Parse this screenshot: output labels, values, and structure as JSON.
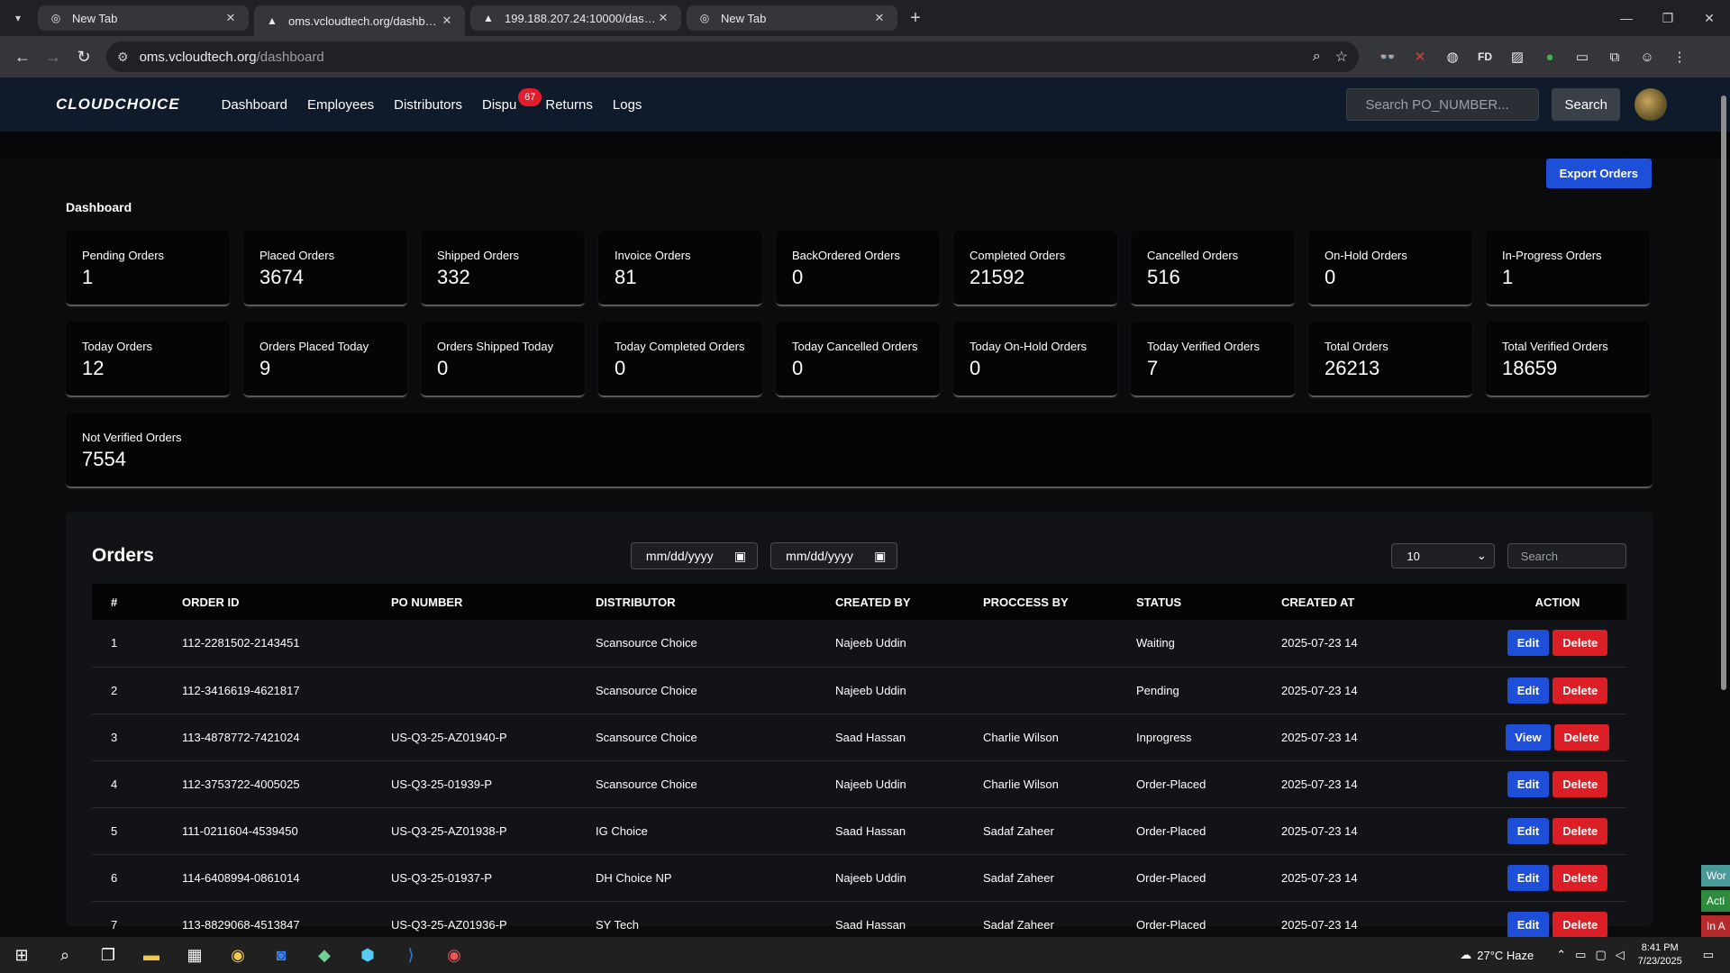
{
  "browser": {
    "tabs": [
      {
        "title": "New Tab",
        "active": false
      },
      {
        "title": "oms.vcloudtech.org/dashboard",
        "active": true
      },
      {
        "title": "199.188.207.24:10000/dashboa",
        "active": false
      },
      {
        "title": "New Tab",
        "active": false
      }
    ],
    "url_host": "oms.vcloudtech.org",
    "url_path": "/dashboard"
  },
  "nav": {
    "logo": "CLOUDCHOICE",
    "links": [
      "Dashboard",
      "Employees",
      "Distributors",
      "Dispu",
      "Returns",
      "Logs"
    ],
    "disputes_badge": "67",
    "search_placeholder": "Search PO_NUMBER...",
    "search_button": "Search"
  },
  "export_button": "Export Orders",
  "dashboard_title": "Dashboard",
  "cards_row1": [
    {
      "label": "Pending Orders",
      "value": "1"
    },
    {
      "label": "Placed Orders",
      "value": "3674"
    },
    {
      "label": "Shipped Orders",
      "value": "332"
    },
    {
      "label": "Invoice Orders",
      "value": "81"
    },
    {
      "label": "BackOrdered Orders",
      "value": "0"
    },
    {
      "label": "Completed Orders",
      "value": "21592"
    },
    {
      "label": "Cancelled Orders",
      "value": "516"
    },
    {
      "label": "On-Hold Orders",
      "value": "0"
    },
    {
      "label": "In-Progress Orders",
      "value": "1"
    }
  ],
  "cards_row2": [
    {
      "label": "Today Orders",
      "value": "12"
    },
    {
      "label": "Orders Placed Today",
      "value": "9"
    },
    {
      "label": "Orders Shipped Today",
      "value": "0"
    },
    {
      "label": "Today Completed Orders",
      "value": "0"
    },
    {
      "label": "Today Cancelled Orders",
      "value": "0"
    },
    {
      "label": "Today On-Hold Orders",
      "value": "0"
    },
    {
      "label": "Today Verified Orders",
      "value": "7"
    },
    {
      "label": "Total Orders",
      "value": "26213"
    },
    {
      "label": "Total Verified Orders",
      "value": "18659"
    }
  ],
  "card_not_verified": {
    "label": "Not Verified Orders",
    "value": "7554"
  },
  "orders": {
    "title": "Orders",
    "date_from": "mm/dd/yyyy",
    "date_to": "mm/dd/yyyy",
    "page_size": "10",
    "search_placeholder": "Search",
    "columns": [
      "#",
      "ORDER ID",
      "PO NUMBER",
      "DISTRIBUTOR",
      "CREATED BY",
      "PROCCESS BY",
      "STATUS",
      "CREATED AT",
      "ACTION"
    ],
    "rows": [
      {
        "n": "1",
        "order_id": "112-2281502-2143451",
        "po": "",
        "distributor": "Scansource Choice",
        "created_by": "Najeeb Uddin",
        "process_by": "",
        "status": "Waiting",
        "created_at": "2025-07-23 14",
        "action": "Edit",
        "delete": "Delete"
      },
      {
        "n": "2",
        "order_id": "112-3416619-4621817",
        "po": "",
        "distributor": "Scansource Choice",
        "created_by": "Najeeb Uddin",
        "process_by": "",
        "status": "Pending",
        "created_at": "2025-07-23 14",
        "action": "Edit",
        "delete": "Delete"
      },
      {
        "n": "3",
        "order_id": "113-4878772-7421024",
        "po": "US-Q3-25-AZ01940-P",
        "distributor": "Scansource Choice",
        "created_by": "Saad Hassan",
        "process_by": "Charlie Wilson",
        "status": "Inprogress",
        "created_at": "2025-07-23 14",
        "action": "View",
        "delete": "Delete"
      },
      {
        "n": "4",
        "order_id": "112-3753722-4005025",
        "po": "US-Q3-25-01939-P",
        "distributor": "Scansource Choice",
        "created_by": "Najeeb Uddin",
        "process_by": "Charlie Wilson",
        "status": "Order-Placed",
        "created_at": "2025-07-23 14",
        "action": "Edit",
        "delete": "Delete"
      },
      {
        "n": "5",
        "order_id": "111-0211604-4539450",
        "po": "US-Q3-25-AZ01938-P",
        "distributor": "IG Choice",
        "created_by": "Saad Hassan",
        "process_by": "Sadaf Zaheer",
        "status": "Order-Placed",
        "created_at": "2025-07-23 14",
        "action": "Edit",
        "delete": "Delete"
      },
      {
        "n": "6",
        "order_id": "114-6408994-0861014",
        "po": "US-Q3-25-01937-P",
        "distributor": "DH Choice NP",
        "created_by": "Najeeb Uddin",
        "process_by": "Sadaf Zaheer",
        "status": "Order-Placed",
        "created_at": "2025-07-23 14",
        "action": "Edit",
        "delete": "Delete"
      },
      {
        "n": "7",
        "order_id": "113-8829068-4513847",
        "po": "US-Q3-25-AZ01936-P",
        "distributor": "SY Tech",
        "created_by": "Saad Hassan",
        "process_by": "Sadaf Zaheer",
        "status": "Order-Placed",
        "created_at": "2025-07-23 14",
        "action": "Edit",
        "delete": "Delete"
      }
    ]
  },
  "side_widgets": [
    "Wor",
    "Acti",
    "In A"
  ],
  "taskbar": {
    "weather": "27°C  Haze",
    "time": "8:41 PM",
    "date": "7/23/2025"
  }
}
